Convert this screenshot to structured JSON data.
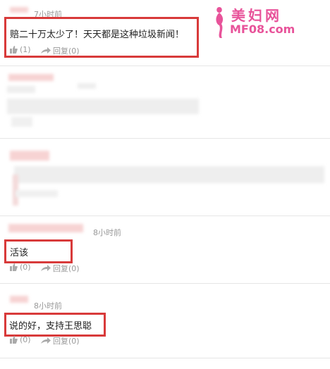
{
  "watermark": {
    "site_name": "美妇网",
    "site_domain": "MF08.com"
  },
  "comments": [
    {
      "time": "7小时前",
      "text": "赔二十万太少了！天天都是这种垃圾新闻！",
      "like_count": "(1)",
      "reply_label": "回复(0)"
    },
    {
      "time": "8小时前",
      "text": "活该",
      "like_count": "(0)",
      "reply_label": "回复(0)"
    },
    {
      "time": "8小时前",
      "text": "说的好，支持王思聪",
      "like_count": "(0)",
      "reply_label": "回复(0)"
    }
  ],
  "colors": {
    "highlight_box": "#d83a3a",
    "watermark_pink": "#e8539a",
    "meta_gray": "#999999"
  }
}
